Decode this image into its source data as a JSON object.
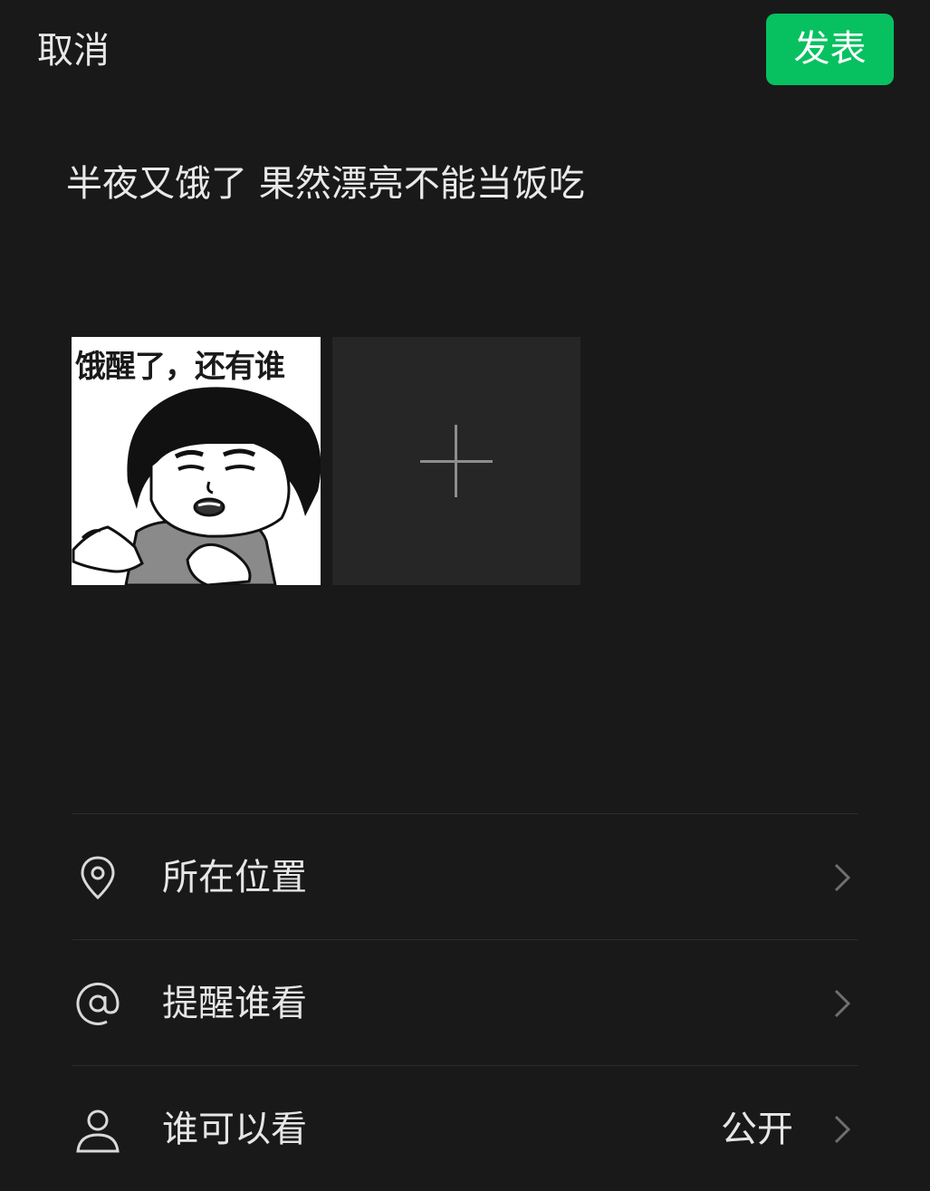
{
  "header": {
    "cancel_label": "取消",
    "publish_label": "发表",
    "publish_color": "#07c160"
  },
  "post": {
    "text": "半夜又饿了 果然漂亮不能当饭吃"
  },
  "media": {
    "images": [
      {
        "caption": "饿醒了，还有谁",
        "icon": "meme-image"
      }
    ],
    "add_icon": "plus-icon"
  },
  "options": [
    {
      "icon": "location-pin-icon",
      "label": "所在位置",
      "value": ""
    },
    {
      "icon": "at-sign-icon",
      "label": "提醒谁看",
      "value": ""
    },
    {
      "icon": "person-icon",
      "label": "谁可以看",
      "value": "公开"
    }
  ],
  "colors": {
    "background": "#191919",
    "tile": "#262626",
    "divider": "#2c2c2c"
  }
}
